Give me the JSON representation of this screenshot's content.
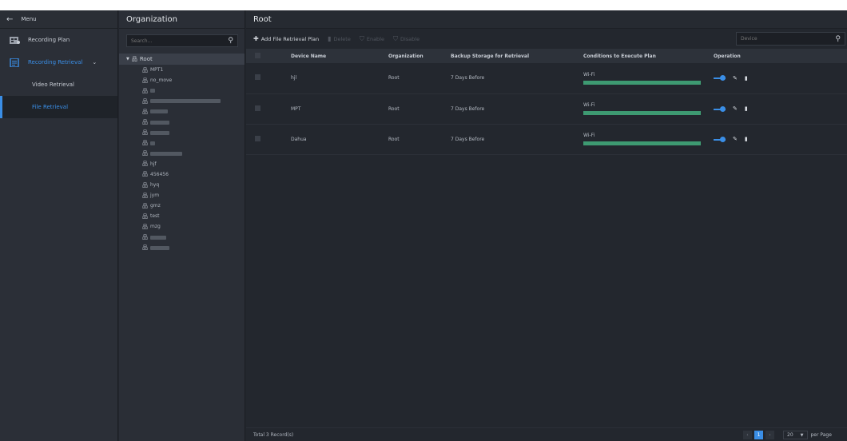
{
  "menu": {
    "back_label": "Menu",
    "items": [
      {
        "label": "Recording Plan",
        "icon": "recording-plan-icon"
      },
      {
        "label": "Recording Retrieval",
        "icon": "recording-retrieval-icon",
        "active": true
      }
    ],
    "sub_items": [
      {
        "label": "Video Retrieval"
      },
      {
        "label": "File Retrieval",
        "selected": true
      }
    ]
  },
  "org": {
    "title": "Organization",
    "search_placeholder": "Search...",
    "root_label": "Root",
    "nodes": [
      {
        "label": "MPT1"
      },
      {
        "label": "no_move"
      },
      {
        "label": "",
        "blurred": true,
        "blur_w": 6
      },
      {
        "label": "",
        "blurred": true,
        "blur_w": 88
      },
      {
        "label": "",
        "blurred": true,
        "blur_w": 22
      },
      {
        "label": "",
        "blurred": true,
        "blur_w": 24
      },
      {
        "label": "",
        "blurred": true,
        "blur_w": 24
      },
      {
        "label": "",
        "blurred": true,
        "blur_w": 6
      },
      {
        "label": "",
        "blurred": true,
        "blur_w": 40
      },
      {
        "label": "hjf"
      },
      {
        "label": "456456"
      },
      {
        "label": "hyq"
      },
      {
        "label": "jym"
      },
      {
        "label": "gmz"
      },
      {
        "label": "test"
      },
      {
        "label": "mzg"
      },
      {
        "label": "",
        "blurred": true,
        "blur_w": 20
      },
      {
        "label": "",
        "blurred": true,
        "blur_w": 24
      }
    ]
  },
  "main": {
    "title": "Root",
    "toolbar": {
      "add": "Add File Retrieval Plan",
      "delete": "Delete",
      "enable": "Enable",
      "disable": "Disable",
      "search_placeholder": "Device"
    },
    "columns": [
      "Device Name",
      "Organization",
      "Backup Storage for Retrieval",
      "Conditions to Execute Plan",
      "Operation"
    ],
    "rows": [
      {
        "device": "hjl",
        "org": "Root",
        "backup": "7 Days Before",
        "condition": "Wi-Fi",
        "condition_progress": 1.0
      },
      {
        "device": "MPT",
        "org": "Root",
        "backup": "7 Days Before",
        "condition": "Wi-Fi",
        "condition_progress": 1.0
      },
      {
        "device": "Dahua",
        "org": "Root",
        "backup": "7 Days Before",
        "condition": "Wi-Fi",
        "condition_progress": 1.0
      }
    ],
    "footer": {
      "total": "Total 3 Record(s)",
      "current_page": "1",
      "per_page_value": "20",
      "per_page_label": "per Page"
    }
  },
  "colors": {
    "accent": "#3a8ee6",
    "condition_bar": "#3e9a72",
    "background": "#22262d"
  }
}
